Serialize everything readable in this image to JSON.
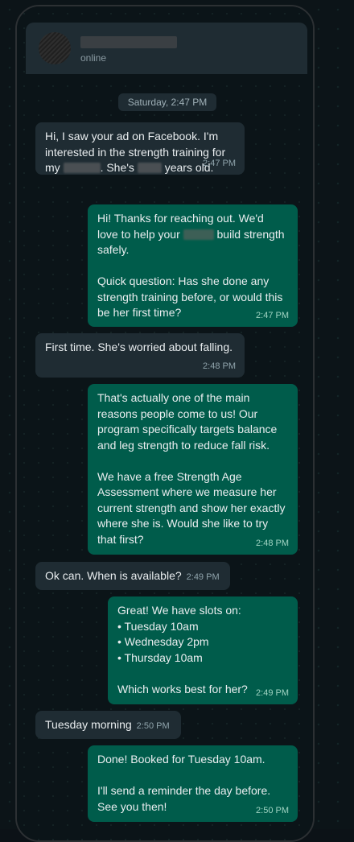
{
  "header": {
    "status": "online"
  },
  "date_divider": "Saturday, 2:47 PM",
  "messages": [
    {
      "direction": "in",
      "lines": [
        "Hi, I saw your ad on Facebook. I'm",
        "interested in the strength training for",
        "my",
        ". She's",
        "years old."
      ],
      "time": "2:47 PM"
    },
    {
      "direction": "out",
      "lines": [
        "Hi! Thanks for reaching out. We'd",
        "love to help your",
        "build strength",
        "safely.",
        "Quick question: Has she done any",
        "strength training before, or would this",
        "be her first time?"
      ],
      "time": "2:47 PM"
    },
    {
      "direction": "in",
      "lines": [
        "First time. She's worried about falling."
      ],
      "time": "2:48 PM"
    },
    {
      "direction": "out",
      "lines": [
        "That's actually one of the main",
        "reasons people come to us! Our",
        "program specifically targets balance",
        "and leg strength to reduce fall risk.",
        "We have a free Strength Age",
        "Assessment where we measure her",
        "current strength and show her exactly",
        "where she is. Would she like to try",
        "that first?"
      ],
      "time": "2:48 PM"
    },
    {
      "direction": "in",
      "lines": [
        "Ok can. When is available?"
      ],
      "time": "2:49 PM"
    },
    {
      "direction": "out",
      "lines": [
        "Great! We have slots on:",
        "• Tuesday 10am",
        "• Wednesday 2pm",
        "• Thursday 10am",
        "Which works best for her?"
      ],
      "time": "2:49 PM"
    },
    {
      "direction": "in",
      "lines": [
        "Tuesday morning"
      ],
      "time": "2:50 PM"
    },
    {
      "direction": "out",
      "lines": [
        "Done! Booked for Tuesday 10am.",
        "I'll send a reminder the day before.",
        "See you then!"
      ],
      "time": "2:50 PM"
    }
  ],
  "colors": {
    "incoming_bubble": "#1f2c33",
    "outgoing_bubble": "#005c4b",
    "chat_background": "#0b1418",
    "text": "#e9edef"
  }
}
